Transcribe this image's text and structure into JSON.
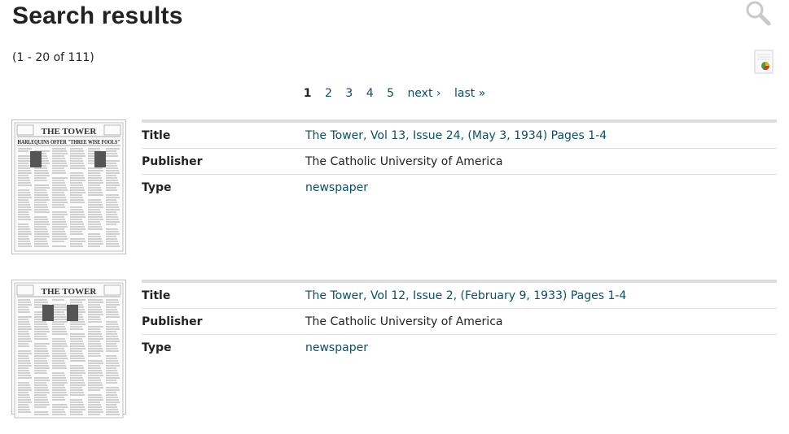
{
  "header": {
    "title": "Search results",
    "count": "(1 - 20 of 111)"
  },
  "icons": {
    "search": "search-icon",
    "report": "report-chart-icon"
  },
  "pagination": {
    "current": "1",
    "pages": [
      "2",
      "3",
      "4",
      "5"
    ],
    "next": "next ›",
    "last": "last »"
  },
  "results": [
    {
      "thumbnail": "newspaper-thumbnail",
      "masthead": "THE TOWER",
      "headline": "HARLEQUINS OFFER \"THREE WISE FOOLS\"",
      "fields": [
        {
          "label": "Title",
          "value": "The Tower, Vol 13, Issue 24, (May 3, 1934) Pages 1-4",
          "link": true
        },
        {
          "label": "Publisher",
          "value": "The Catholic University of America",
          "link": false
        },
        {
          "label": "Type",
          "value": "newspaper",
          "link": true
        }
      ]
    },
    {
      "thumbnail": "newspaper-thumbnail",
      "masthead": "THE TOWER",
      "headline": "",
      "fields": [
        {
          "label": "Title",
          "value": "The Tower, Vol 12, Issue 2, (February 9, 1933) Pages 1-4",
          "link": true
        },
        {
          "label": "Publisher",
          "value": "The Catholic University of America",
          "link": false
        },
        {
          "label": "Type",
          "value": "newspaper",
          "link": true
        }
      ]
    }
  ],
  "colors": {
    "link": "#0b4f6c",
    "text": "#222222",
    "divider": "#dcdcdc"
  }
}
